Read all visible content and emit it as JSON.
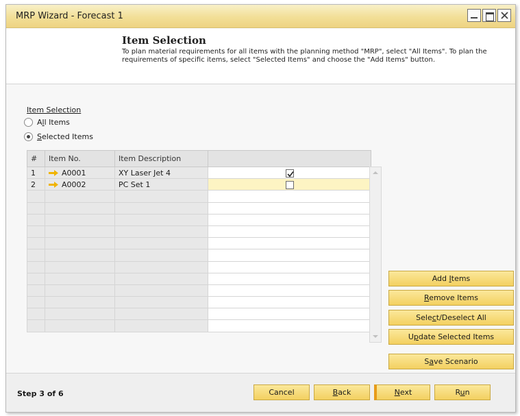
{
  "window": {
    "title": "MRP Wizard - Forecast 1"
  },
  "header": {
    "heading": "Item Selection",
    "description": "To plan material requirements for all items with the planning method \"MRP\", select \"All Items\". To plan the requirements of specific items, select \"Selected Items\" and choose the \"Add Items\" button."
  },
  "item_selection": {
    "label": "Item Selection",
    "options": [
      {
        "label": "All Items",
        "checked": false
      },
      {
        "label": "Selected Items",
        "checked": true
      }
    ]
  },
  "grid": {
    "columns": [
      "#",
      "Item No.",
      "Item Description",
      ""
    ],
    "rows": [
      {
        "num": "1",
        "item_no": "A0001",
        "description": "XY Laser Jet 4",
        "checked": true
      },
      {
        "num": "2",
        "item_no": "A0002",
        "description": "PC Set 1",
        "checked": false
      }
    ],
    "empty_rows": 12
  },
  "side_buttons": {
    "add_items": "Add Items",
    "remove_items": "Remove Items",
    "select_deselect_all": "Select/Deselect All",
    "update_selected_items": "Update Selected Items",
    "save_scenario": "Save Scenario"
  },
  "footer": {
    "step": "Step 3 of 6",
    "cancel": "Cancel",
    "back": "Back",
    "next": "Next",
    "run": "Run"
  },
  "icons": {
    "row_link": "link-arrow-icon",
    "checkbox_checked": "checkmark-icon"
  },
  "colors": {
    "title_bar": "#f2df97",
    "button": "#f3d060",
    "row_highlight": "#fdf4c3",
    "link_arrow": "#f0b400"
  }
}
